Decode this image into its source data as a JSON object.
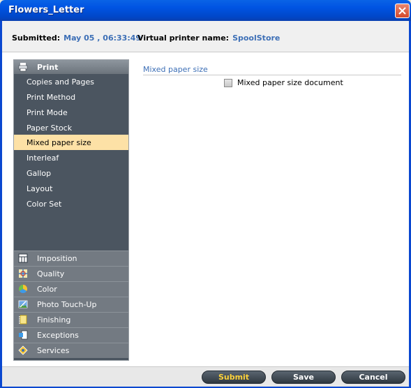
{
  "window": {
    "title": "Flowers_Letter"
  },
  "info": {
    "submitted_label": "Submitted:",
    "submitted_value": "May 05 , 06:33:49",
    "printer_label": "Virtual printer name:",
    "printer_value": "SpoolStore"
  },
  "sidebar": {
    "section_title": "Print",
    "items": [
      {
        "label": "Copies and Pages"
      },
      {
        "label": "Print Method"
      },
      {
        "label": "Print Mode"
      },
      {
        "label": "Paper Stock"
      },
      {
        "label": "Mixed paper size"
      },
      {
        "label": "Interleaf"
      },
      {
        "label": "Gallop"
      },
      {
        "label": "Layout"
      },
      {
        "label": "Color Set"
      }
    ],
    "groups": [
      {
        "label": "Imposition"
      },
      {
        "label": "Quality"
      },
      {
        "label": "Color"
      },
      {
        "label": "Photo Touch-Up"
      },
      {
        "label": "Finishing"
      },
      {
        "label": "Exceptions"
      },
      {
        "label": "Services"
      }
    ]
  },
  "content": {
    "title": "Mixed paper size",
    "checkbox_label": "Mixed paper size document"
  },
  "buttons": {
    "submit": "Submit",
    "save": "Save",
    "cancel": "Cancel"
  }
}
